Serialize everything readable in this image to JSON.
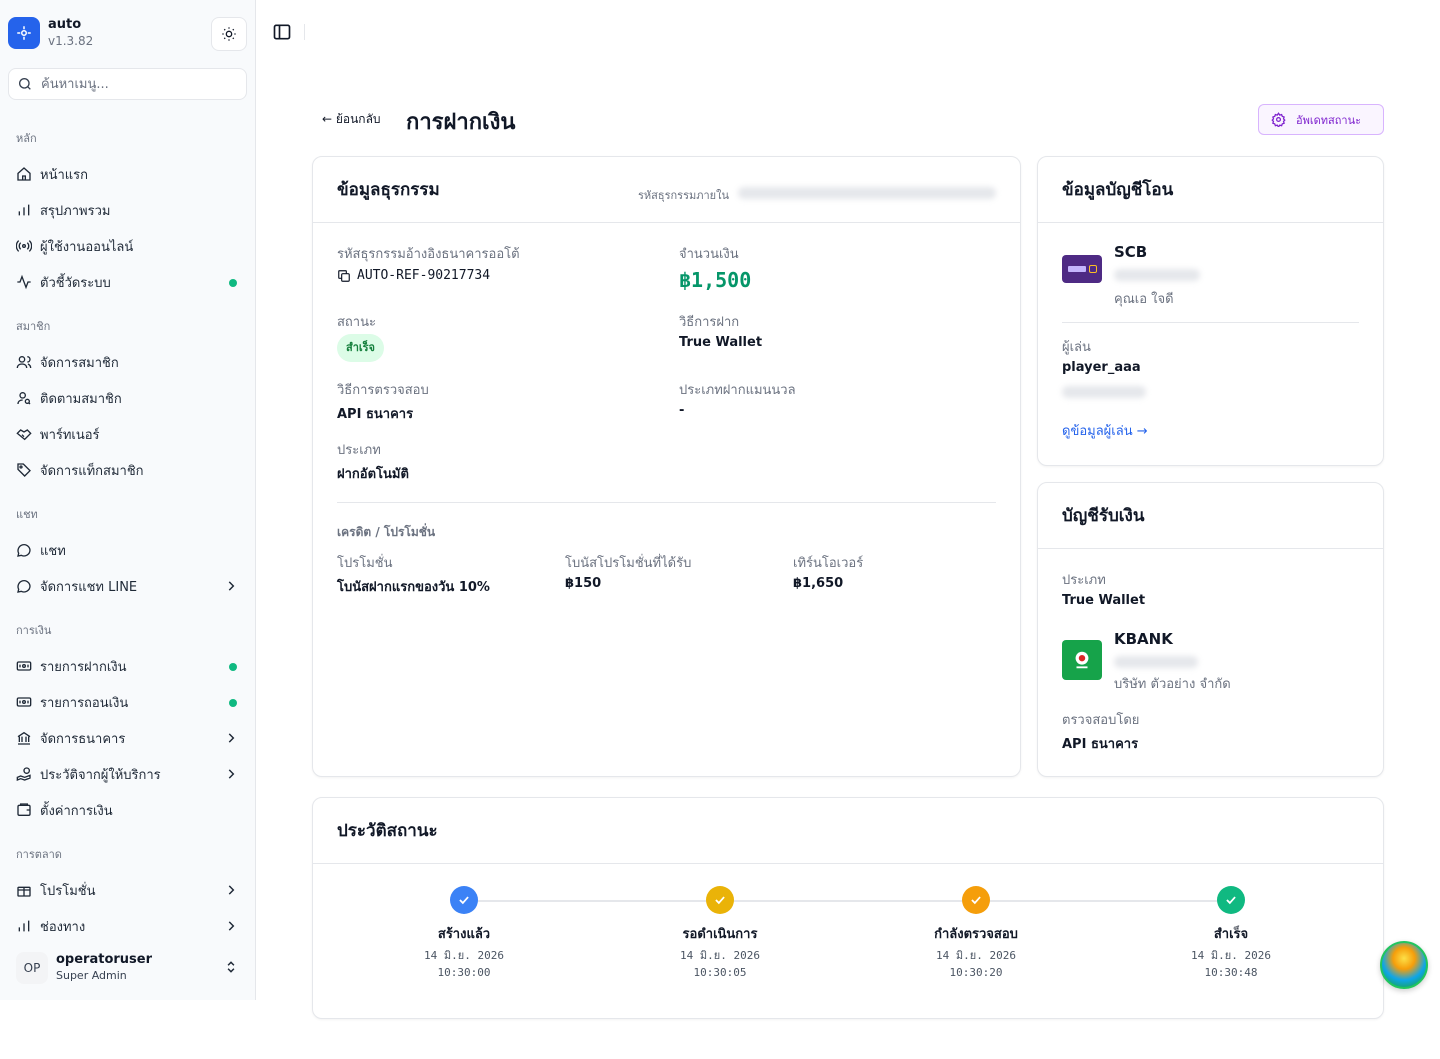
{
  "app": {
    "name": "auto",
    "version": "v1.3.82"
  },
  "search": {
    "placeholder": "ค้นหาเมนู..."
  },
  "nav": {
    "main_label": "หลัก",
    "main": [
      "หน้าแรก",
      "สรุปภาพรวม",
      "ผู้ใช้งานออนไลน์",
      "ตัวชี้วัดระบบ"
    ],
    "members_label": "สมาชิก",
    "members": [
      "จัดการสมาชิก",
      "ติดตามสมาชิก",
      "พาร์ทเนอร์",
      "จัดการแท็กสมาชิก"
    ],
    "chat_label": "แชท",
    "chat": [
      "แชท",
      "จัดการแชท LINE"
    ],
    "finance_label": "การเงิน",
    "finance": [
      "รายการฝากเงิน",
      "รายการถอนเงิน",
      "จัดการธนาคาร",
      "ประวัติจากผู้ให้บริการ",
      "ตั้งค่าการเงิน"
    ],
    "marketing_label": "การตลาด",
    "marketing": [
      "โปรโมชั่น",
      "ช่องทาง"
    ]
  },
  "user": {
    "initials": "OP",
    "name": "operatoruser",
    "role": "Super Admin"
  },
  "header": {
    "back": "← ย้อนกลับ",
    "title": "การฝากเงิน",
    "update_button": "อัพเดทสถานะ"
  },
  "transaction": {
    "title": "ข้อมูลธุรกรรม",
    "internal_id_label": "รหัสธุรกรรมภายใน",
    "ref_label": "รหัสธุรกรรมอ้างอิงธนาคารออโต้",
    "ref_value": "AUTO-REF-90217734",
    "amount_label": "จำนวนเงิน",
    "amount_value": "฿1,500",
    "status_label": "สถานะ",
    "status_value": "สำเร็จ",
    "method_label": "วิธีการฝาก",
    "method_value": "True Wallet",
    "verify_label": "วิธีการตรวจสอบ",
    "verify_value": "API ธนาคาร",
    "manual_type_label": "ประเภทฝากแมนนวล",
    "manual_type_value": "-",
    "type_label": "ประเภท",
    "type_value": "ฝากอัตโนมัติ",
    "credit_head": "เครดิต / โปรโมชั่น",
    "promo_label": "โปรโมชั่น",
    "promo_value": "โบนัสฝากแรกของวัน 10%",
    "bonus_label": "โบนัสโปรโมชั่นที่ได้รับ",
    "bonus_value": "฿150",
    "turnover_label": "เทิร์นโอเวอร์",
    "turnover_value": "฿1,650"
  },
  "transfer_account": {
    "title": "ข้อมูลบัญชีโอน",
    "bank": "SCB",
    "account_name": "คุณเอ ใจดี",
    "player_label": "ผู้เล่น",
    "player_value": "player_aaa",
    "player_link": "ดูข้อมูลผู้เล่น →"
  },
  "receive_account": {
    "title": "บัญชีรับเงิน",
    "type_label": "ประเภท",
    "type_value": "True Wallet",
    "bank": "KBANK",
    "account_name": "บริษัท ตัวอย่าง จำกัด",
    "verified_by_label": "ตรวจสอบโดย",
    "verified_by_value": "API ธนาคาร"
  },
  "history": {
    "title": "ประวัติสถานะ",
    "steps": [
      {
        "label": "สร้างแล้ว",
        "date": "14 มิ.ย. 2026",
        "time": "10:30:00",
        "color": "#3b82f6"
      },
      {
        "label": "รอดำเนินการ",
        "date": "14 มิ.ย. 2026",
        "time": "10:30:05",
        "color": "#eab308"
      },
      {
        "label": "กำลังตรวจสอบ",
        "date": "14 มิ.ย. 2026",
        "time": "10:30:20",
        "color": "#f59e0b"
      },
      {
        "label": "สำเร็จ",
        "date": "14 มิ.ย. 2026",
        "time": "10:30:48",
        "color": "#10b981"
      }
    ]
  },
  "colors": {
    "brand": "#2563eb",
    "success": "#059669",
    "accent_purple": "#7e22ce"
  }
}
